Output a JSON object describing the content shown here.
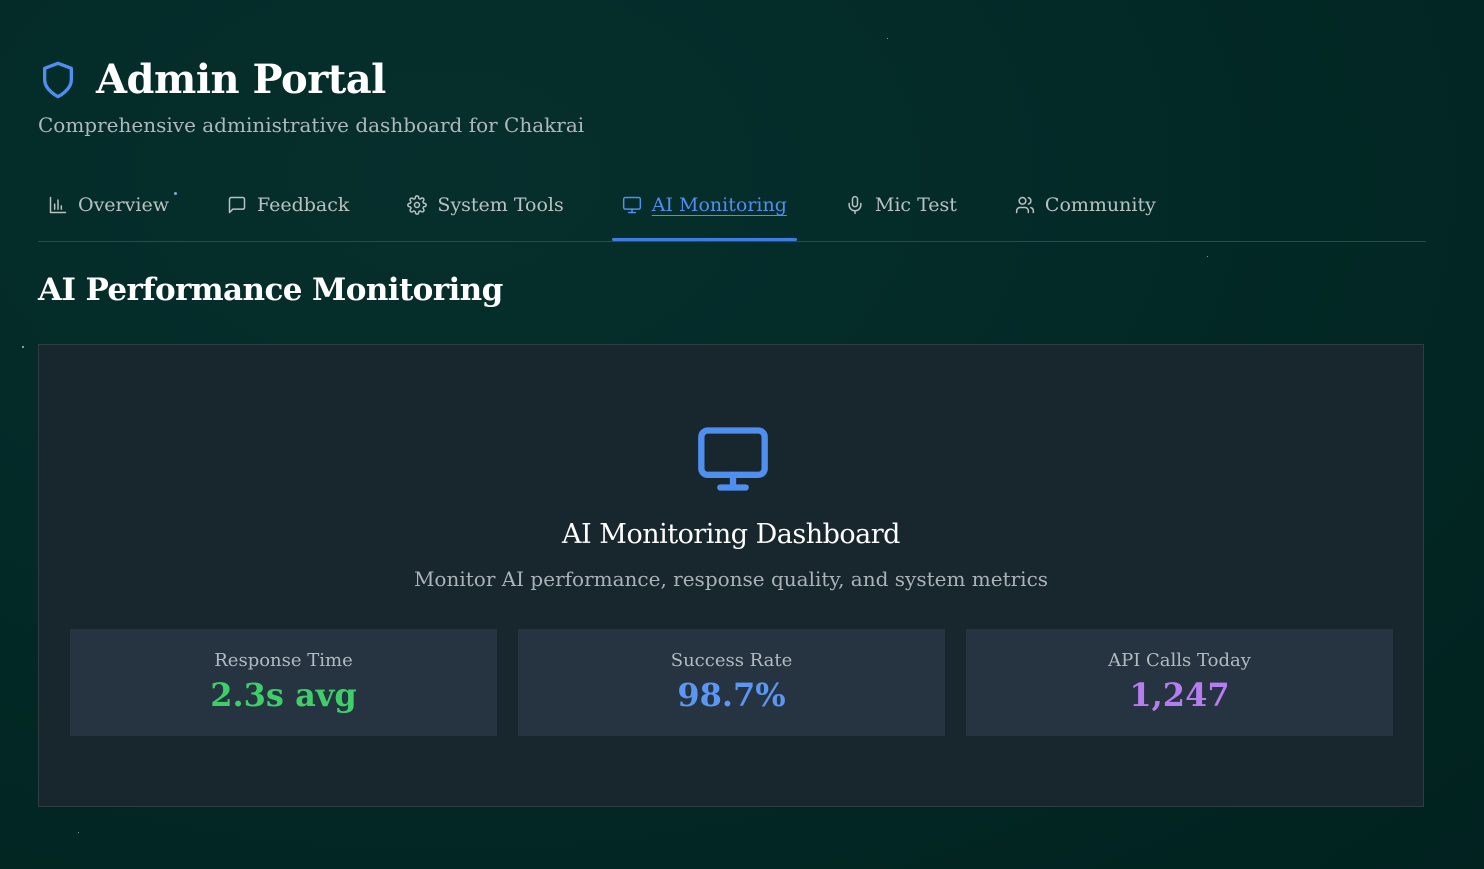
{
  "header": {
    "title": "Admin Portal",
    "subtitle": "Comprehensive administrative dashboard for Chakrai",
    "logo_icon": "shield-icon"
  },
  "tabs": [
    {
      "label": "Overview",
      "icon": "bar-chart-icon",
      "active": false
    },
    {
      "label": "Feedback",
      "icon": "message-square-icon",
      "active": false
    },
    {
      "label": "System Tools",
      "icon": "gear-icon",
      "active": false
    },
    {
      "label": "AI Monitoring",
      "icon": "monitor-icon",
      "active": true
    },
    {
      "label": "Mic Test",
      "icon": "microphone-icon",
      "active": false
    },
    {
      "label": "Community",
      "icon": "users-icon",
      "active": false
    }
  ],
  "section": {
    "title": "AI Performance Monitoring"
  },
  "panel": {
    "icon": "monitor-icon",
    "title": "AI Monitoring Dashboard",
    "description": "Monitor AI performance, response quality, and system metrics"
  },
  "stats": [
    {
      "label": "Response Time",
      "value": "2.3s avg",
      "color": "#3fcf6a"
    },
    {
      "label": "Success Rate",
      "value": "98.7%",
      "color": "#5b96f2"
    },
    {
      "label": "API Calls Today",
      "value": "1,247",
      "color": "#b57ef0"
    }
  ],
  "colors": {
    "background": "#022727",
    "accent": "#4f8ff0",
    "panel": "#18262e",
    "card": "#263340"
  }
}
